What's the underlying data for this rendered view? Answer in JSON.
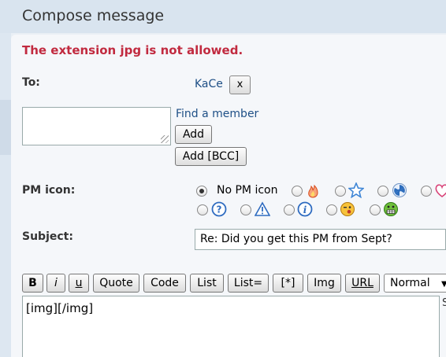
{
  "page": {
    "title": "Compose message"
  },
  "error": {
    "message": "The extension jpg is not allowed."
  },
  "to": {
    "label": "To:",
    "recipient": "KaCe",
    "remove_label": "x",
    "input_value": "",
    "find_member_label": "Find a member",
    "add_label": "Add",
    "add_bcc_label": "Add [BCC]"
  },
  "pm_icon": {
    "label": "PM icon:",
    "none_label": "No PM icon",
    "options": [
      "fire-icon",
      "star-icon",
      "radioactive-icon",
      "heart-icon",
      "question-icon",
      "warning-icon",
      "info-icon",
      "wink-smiley-icon",
      "grin-smiley-icon"
    ],
    "selected": "No PM icon"
  },
  "subject": {
    "label": "Subject:",
    "value": "Re: Did you get this PM from Sept?"
  },
  "toolbar": {
    "bold": "B",
    "italic": "i",
    "underline": "u",
    "quote": "Quote",
    "code": "Code",
    "list": "List",
    "list_eq": "List=",
    "list_item": "[*]",
    "img": "Img",
    "url": "URL",
    "size": "Normal"
  },
  "editor": {
    "value": "[img][/img]",
    "side_text": "S"
  },
  "colors": {
    "error": "#c12a3f",
    "link": "#1e4f86",
    "header_bg": "#d9e4ef"
  }
}
